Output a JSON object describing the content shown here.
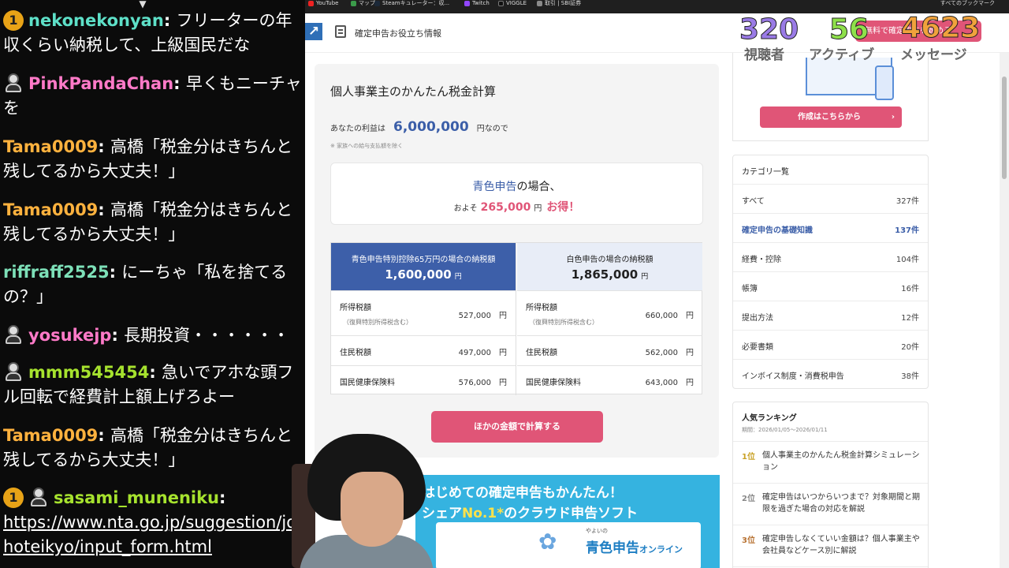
{
  "chat": {
    "messages": [
      {
        "badge": "1",
        "user": "nekonekonyan",
        "color": "#5ee0c8",
        "text": "フリーターの年収くらい納税して、上級国民だな"
      },
      {
        "avatar": "avatar-icon",
        "user": "PinkPandaChan",
        "color": "#ff7ac8",
        "text": "早くもニーチャを"
      },
      {
        "user": "Tama0009",
        "color": "#ffb23e",
        "text": "高橋「税金分はきちんと残してるから大丈夫！」"
      },
      {
        "user": "Tama0009",
        "color": "#ffb23e",
        "text": "高橋「税金分はきちんと残してるから大丈夫！」"
      },
      {
        "user": "riffraff2525",
        "color": "#7de0b8",
        "text": "にーちゃ「私を捨てるの？」"
      },
      {
        "avatar": "avatar-icon",
        "user": "yosukejp",
        "color": "#ff7ac8",
        "text": "長期投資・・・・・・"
      },
      {
        "avatar": "avatar-icon",
        "user": "mmm545454",
        "color": "#a6e22e",
        "text": "急いでアホな頭フル回転で経費計上額上げろよー"
      },
      {
        "user": "Tama0009",
        "color": "#ffb23e",
        "text": "高橋「税金分はきちんと残してるから大丈夫！」"
      },
      {
        "badge": "1",
        "avatar": "avatar-icon",
        "user": "sasami_muneniku",
        "color": "#a6e22e",
        "text": "https://www.nta.go.jp/suggestion/johoteikyo/input_form.html"
      }
    ]
  },
  "bookmarks": {
    "items": [
      "YouTube",
      "マップ",
      "Steamキュレーター：収...",
      "Twitch",
      "VIGGLE",
      "取引 | SBI証券"
    ],
    "right": "すべてのブックマーク"
  },
  "header": {
    "nav_title": "確定申告お役立ち情報",
    "cta": "無料で確定申告を始める"
  },
  "stream_stats": {
    "viewers": "320",
    "viewers_label": "視聴者",
    "active": "56",
    "active_label": "アクティブ",
    "messages": "4623",
    "messages_label": "メッセージ",
    "colors": {
      "viewers": "#9a7be6",
      "active": "#8ee04a",
      "messages": "#f0a23c"
    }
  },
  "calc": {
    "title": "個人事業主のかんたん税金計算",
    "profit_prefix": "あなたの利益は",
    "profit_value": "6,000,000",
    "profit_suffix": "円なので",
    "note": "※ 家族への給与支払額を除く",
    "save_line1_blue": "青色申告",
    "save_line1_rest": "の場合、",
    "save_line2_prefix": "およそ",
    "save_amount": "265,000",
    "save_unit": "円",
    "save_gain": "お得！",
    "blue": {
      "head": "青色申告特別控除65万円の場合の納税額",
      "total": "1,600,000",
      "unit": "円",
      "rows": [
        {
          "label": "所得税額",
          "sub": "（復興特別所得税含む）",
          "value": "527,000　円"
        },
        {
          "label": "住民税額",
          "value": "497,000　円"
        },
        {
          "label": "国民健康保険料",
          "value": "576,000　円"
        }
      ]
    },
    "white": {
      "head": "白色申告の場合の納税額",
      "total": "1,865,000",
      "unit": "円",
      "rows": [
        {
          "label": "所得税額",
          "sub": "（復興特別所得税含む）",
          "value": "660,000　円"
        },
        {
          "label": "住民税額",
          "value": "562,000　円"
        },
        {
          "label": "国民健康保険料",
          "value": "643,000　円"
        }
      ]
    },
    "recalc_label": "ほかの金額で計算する"
  },
  "ad": {
    "line1": "はじめての確定申告もかんたん！",
    "line2_pre": "シェア",
    "line2_hi": "No.1*",
    "line2_post": "のクラウド申告ソフト",
    "small": "やよいの",
    "name": "青色申告",
    "name_suffix": "オンライン"
  },
  "sidebar": {
    "promo_button": "作成はこちらから",
    "category_title": "カテゴリ一覧",
    "categories": [
      {
        "name": "すべて",
        "count": "327件"
      },
      {
        "name": "確定申告の基礎知識",
        "count": "137件"
      },
      {
        "name": "経費・控除",
        "count": "104件"
      },
      {
        "name": "帳簿",
        "count": "16件"
      },
      {
        "name": "提出方法",
        "count": "12件"
      },
      {
        "name": "必要書類",
        "count": "20件"
      },
      {
        "name": "インボイス制度・消費税申告",
        "count": "38件"
      }
    ],
    "ranking_title": "人気ランキング",
    "ranking_period": "期間：2026/01/05〜2026/01/11",
    "ranking": [
      {
        "no": "1位",
        "title": "個人事業主のかんたん税金計算シミュレーション"
      },
      {
        "no": "2位",
        "title": "確定申告はいつからいつまで？対象期間と期限を過ぎた場合の対応を解説"
      },
      {
        "no": "3位",
        "title": "確定申告しなくていい金額は？個人事業主や会社員などケース別に解説"
      }
    ]
  }
}
